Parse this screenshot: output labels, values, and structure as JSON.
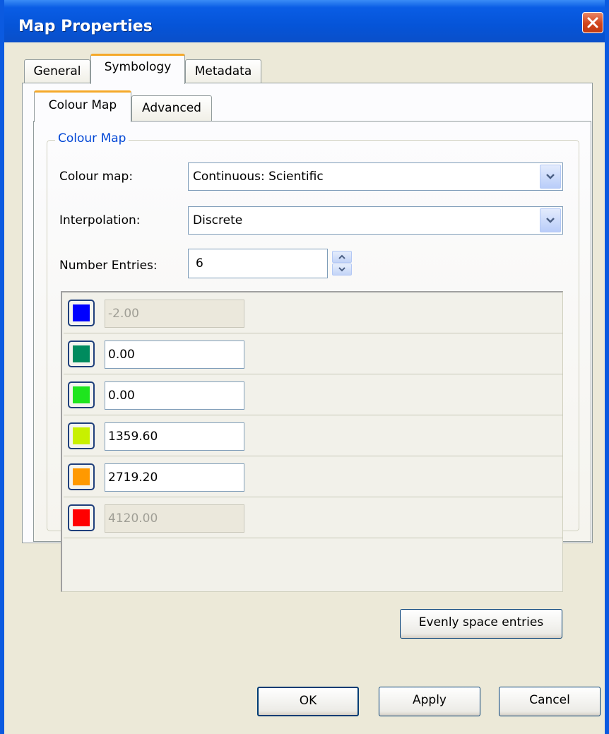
{
  "window": {
    "title": "Map Properties"
  },
  "tabs": [
    "General",
    "Symbology",
    "Metadata"
  ],
  "subtabs": [
    "Colour Map",
    "Advanced"
  ],
  "group": {
    "legend": "Colour Map"
  },
  "colour_map": {
    "label": "Colour map:",
    "value": "Continuous: Scientific"
  },
  "interpolation": {
    "label": "Interpolation:",
    "value": "Discrete"
  },
  "number_entries": {
    "label": "Number Entries:",
    "value": "6"
  },
  "entries": [
    {
      "color": "#0000ff",
      "value": "-2.00",
      "editable": false
    },
    {
      "color": "#008b5e",
      "value": "0.00",
      "editable": true
    },
    {
      "color": "#1ee51e",
      "value": "0.00",
      "editable": true
    },
    {
      "color": "#c8f000",
      "value": "1359.60",
      "editable": true
    },
    {
      "color": "#ff9900",
      "value": "2719.20",
      "editable": true
    },
    {
      "color": "#ff0000",
      "value": "4120.00",
      "editable": false
    }
  ],
  "buttons": {
    "evenly_space": "Evenly space entries",
    "ok": "OK",
    "apply": "Apply",
    "cancel": "Cancel"
  }
}
